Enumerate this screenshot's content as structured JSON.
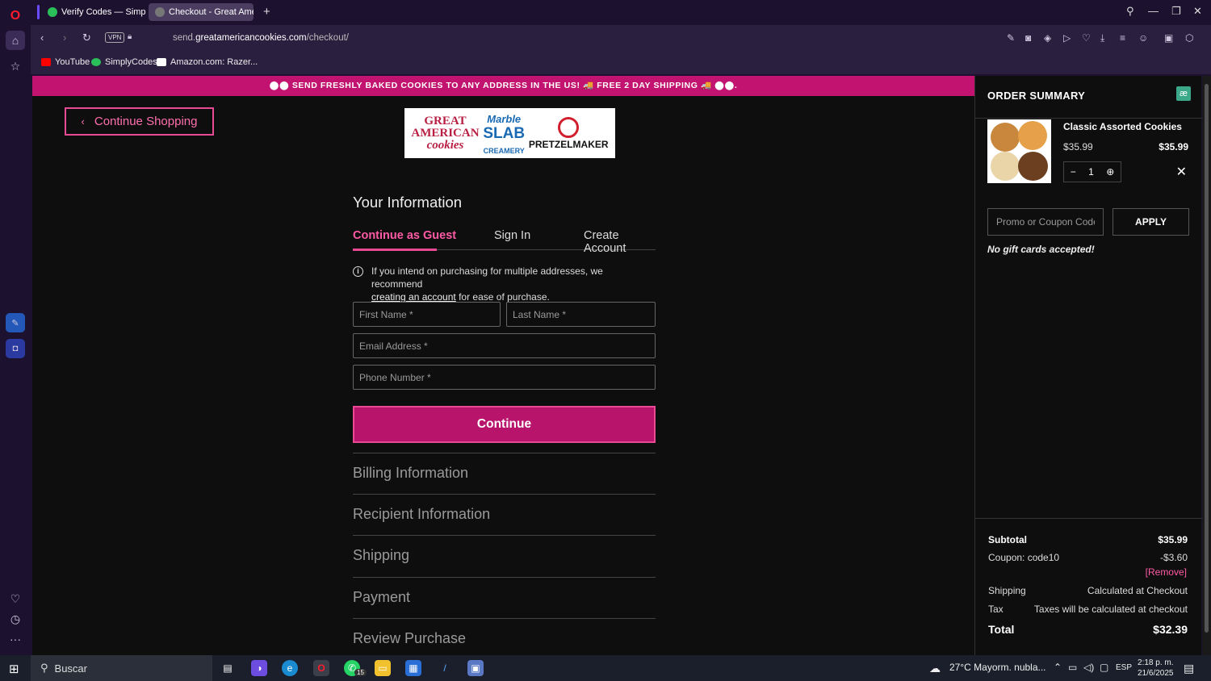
{
  "browser": {
    "tabs": [
      {
        "label": "Verify Codes — SimplyCo",
        "color": "#2bbf5a"
      },
      {
        "label": "Checkout - Great America",
        "color": "#777777"
      }
    ],
    "url_prefix": "send.",
    "url_domain": "greatamericancookies.com",
    "url_path": "/checkout/",
    "vpn_label": "VPN",
    "bookmarks": [
      "YouTube",
      "SimplyCodes",
      "Amazon.com: Razer..."
    ]
  },
  "page": {
    "banner": "⬤⬤ SEND FRESHLY BAKED COOKIES TO ANY ADDRESS IN THE US! 🚚 FREE 2 DAY SHIPPING 🚚 ⬤⬤.",
    "continue_shopping": "Continue Shopping",
    "logo": {
      "brand1": "GREAT AMERICAN cookies",
      "brand2": "Marble SLAB CREAMERY",
      "brand3": "PRETZELMAKER"
    },
    "section_title": "Your Information",
    "tabs": [
      "Continue as Guest",
      "Sign In",
      "Create Account"
    ],
    "info_text_1": "If you intend on purchasing for multiple addresses, we recommend",
    "info_link": "creating an account",
    "info_text_2": "for ease of purchase.",
    "placeholders": {
      "first_name": "First Name *",
      "last_name": "Last Name *",
      "email": "Email Address *",
      "phone": "Phone Number *"
    },
    "continue_button": "Continue",
    "accordion": [
      "Billing Information",
      "Recipient Information",
      "Shipping",
      "Payment",
      "Review Purchase"
    ]
  },
  "summary": {
    "title": "ORDER SUMMARY",
    "product": {
      "name": "Classic Assorted Cookies",
      "price": "$35.99",
      "line_total": "$35.99",
      "qty": "1"
    },
    "promo_placeholder": "Promo or Coupon Code",
    "apply": "APPLY",
    "no_gift": "No gift cards accepted!",
    "subtotal_label": "Subtotal",
    "subtotal": "$35.99",
    "coupon_label": "Coupon: code10",
    "coupon": "-$3.60",
    "remove": "[Remove]",
    "shipping_label": "Shipping",
    "shipping": "Calculated at Checkout",
    "tax_label": "Tax",
    "tax": "Taxes will be calculated at checkout",
    "total_label": "Total",
    "total": "$32.39"
  },
  "taskbar": {
    "search": "Buscar",
    "weather": "27°C  Mayorm. nubla...",
    "lang": "ESP",
    "time": "2:18 p. m.",
    "date": "21/6/2025",
    "whatsapp_badge": "15"
  },
  "colors": {
    "accent": "#c1136f",
    "accent_light": "#e84b94",
    "background": "#0e0e0e"
  }
}
